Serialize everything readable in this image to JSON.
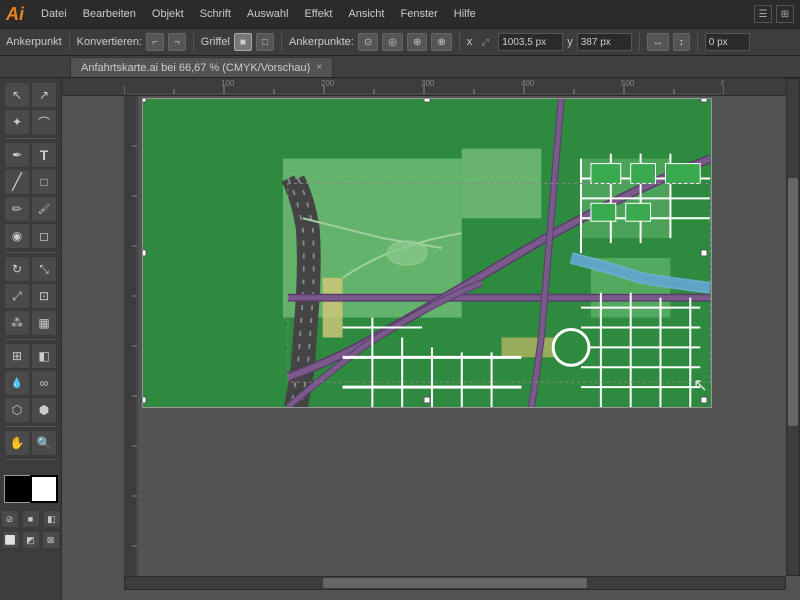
{
  "app": {
    "logo": "Ai",
    "title": "Adobe Illustrator"
  },
  "menu": {
    "items": [
      "Datei",
      "Bearbeiten",
      "Objekt",
      "Schrift",
      "Auswahl",
      "Effekt",
      "Ansicht",
      "Fenster",
      "Hilfe"
    ]
  },
  "toolbar_top": {
    "label_ankerpunkt": "Ankerpunkt",
    "label_konvertieren": "Konvertieren:",
    "label_griffel": "Griffel",
    "label_ankerpunkte": "Ankerpunkte:",
    "input_x": "1003,5 px",
    "label_x": "x",
    "input_y": "387 px",
    "label_y": "y",
    "input_extra": "0 px"
  },
  "tab": {
    "title": "Anfahrtskarte.ai bei 66,67 % (CMYK/Vorschau)",
    "close": "×"
  },
  "tools": [
    {
      "name": "select",
      "icon": "↖",
      "label": "Auswahl"
    },
    {
      "name": "direct-select",
      "icon": "↗",
      "label": "Direkte Auswahl"
    },
    {
      "name": "magic-wand",
      "icon": "✦",
      "label": "Zauberstab"
    },
    {
      "name": "lasso",
      "icon": "⌒",
      "label": "Lasso"
    },
    {
      "name": "pen",
      "icon": "✒",
      "label": "Stift"
    },
    {
      "name": "type",
      "icon": "T",
      "label": "Text"
    },
    {
      "name": "line",
      "icon": "╱",
      "label": "Linie"
    },
    {
      "name": "rectangle",
      "icon": "□",
      "label": "Rechteck"
    },
    {
      "name": "pencil",
      "icon": "✏",
      "label": "Bleistift"
    },
    {
      "name": "brush",
      "icon": "🖌",
      "label": "Pinsel"
    },
    {
      "name": "blob-brush",
      "icon": "◉",
      "label": "Tropfenpinsel"
    },
    {
      "name": "eraser",
      "icon": "◻",
      "label": "Radiergummi"
    },
    {
      "name": "rotate",
      "icon": "↻",
      "label": "Drehen"
    },
    {
      "name": "scale",
      "icon": "⤡",
      "label": "Skalieren"
    },
    {
      "name": "warp",
      "icon": "⤢",
      "label": "Verformen"
    },
    {
      "name": "free-transform",
      "icon": "⊡",
      "label": "Frei transformieren"
    },
    {
      "name": "symbol-sprayer",
      "icon": "⁂",
      "label": "Symbolsprüher"
    },
    {
      "name": "graph",
      "icon": "▦",
      "label": "Diagramm"
    },
    {
      "name": "mesh",
      "icon": "⊞",
      "label": "Gitter"
    },
    {
      "name": "gradient",
      "icon": "◧",
      "label": "Verlauf"
    },
    {
      "name": "eyedropper",
      "icon": "💧",
      "label": "Pipette"
    },
    {
      "name": "blend",
      "icon": "∞",
      "label": "Angleichen"
    },
    {
      "name": "live-paint",
      "icon": "⬡",
      "label": "Interaktiv malen"
    },
    {
      "name": "perspective",
      "icon": "⬢",
      "label": "Perspektivisches Gitter"
    },
    {
      "name": "hand",
      "icon": "✋",
      "label": "Hand"
    },
    {
      "name": "zoom",
      "icon": "🔍",
      "label": "Zoom"
    }
  ],
  "canvas": {
    "zoom": "66.67%",
    "color_mode": "CMYK",
    "mode": "Vorschau"
  }
}
